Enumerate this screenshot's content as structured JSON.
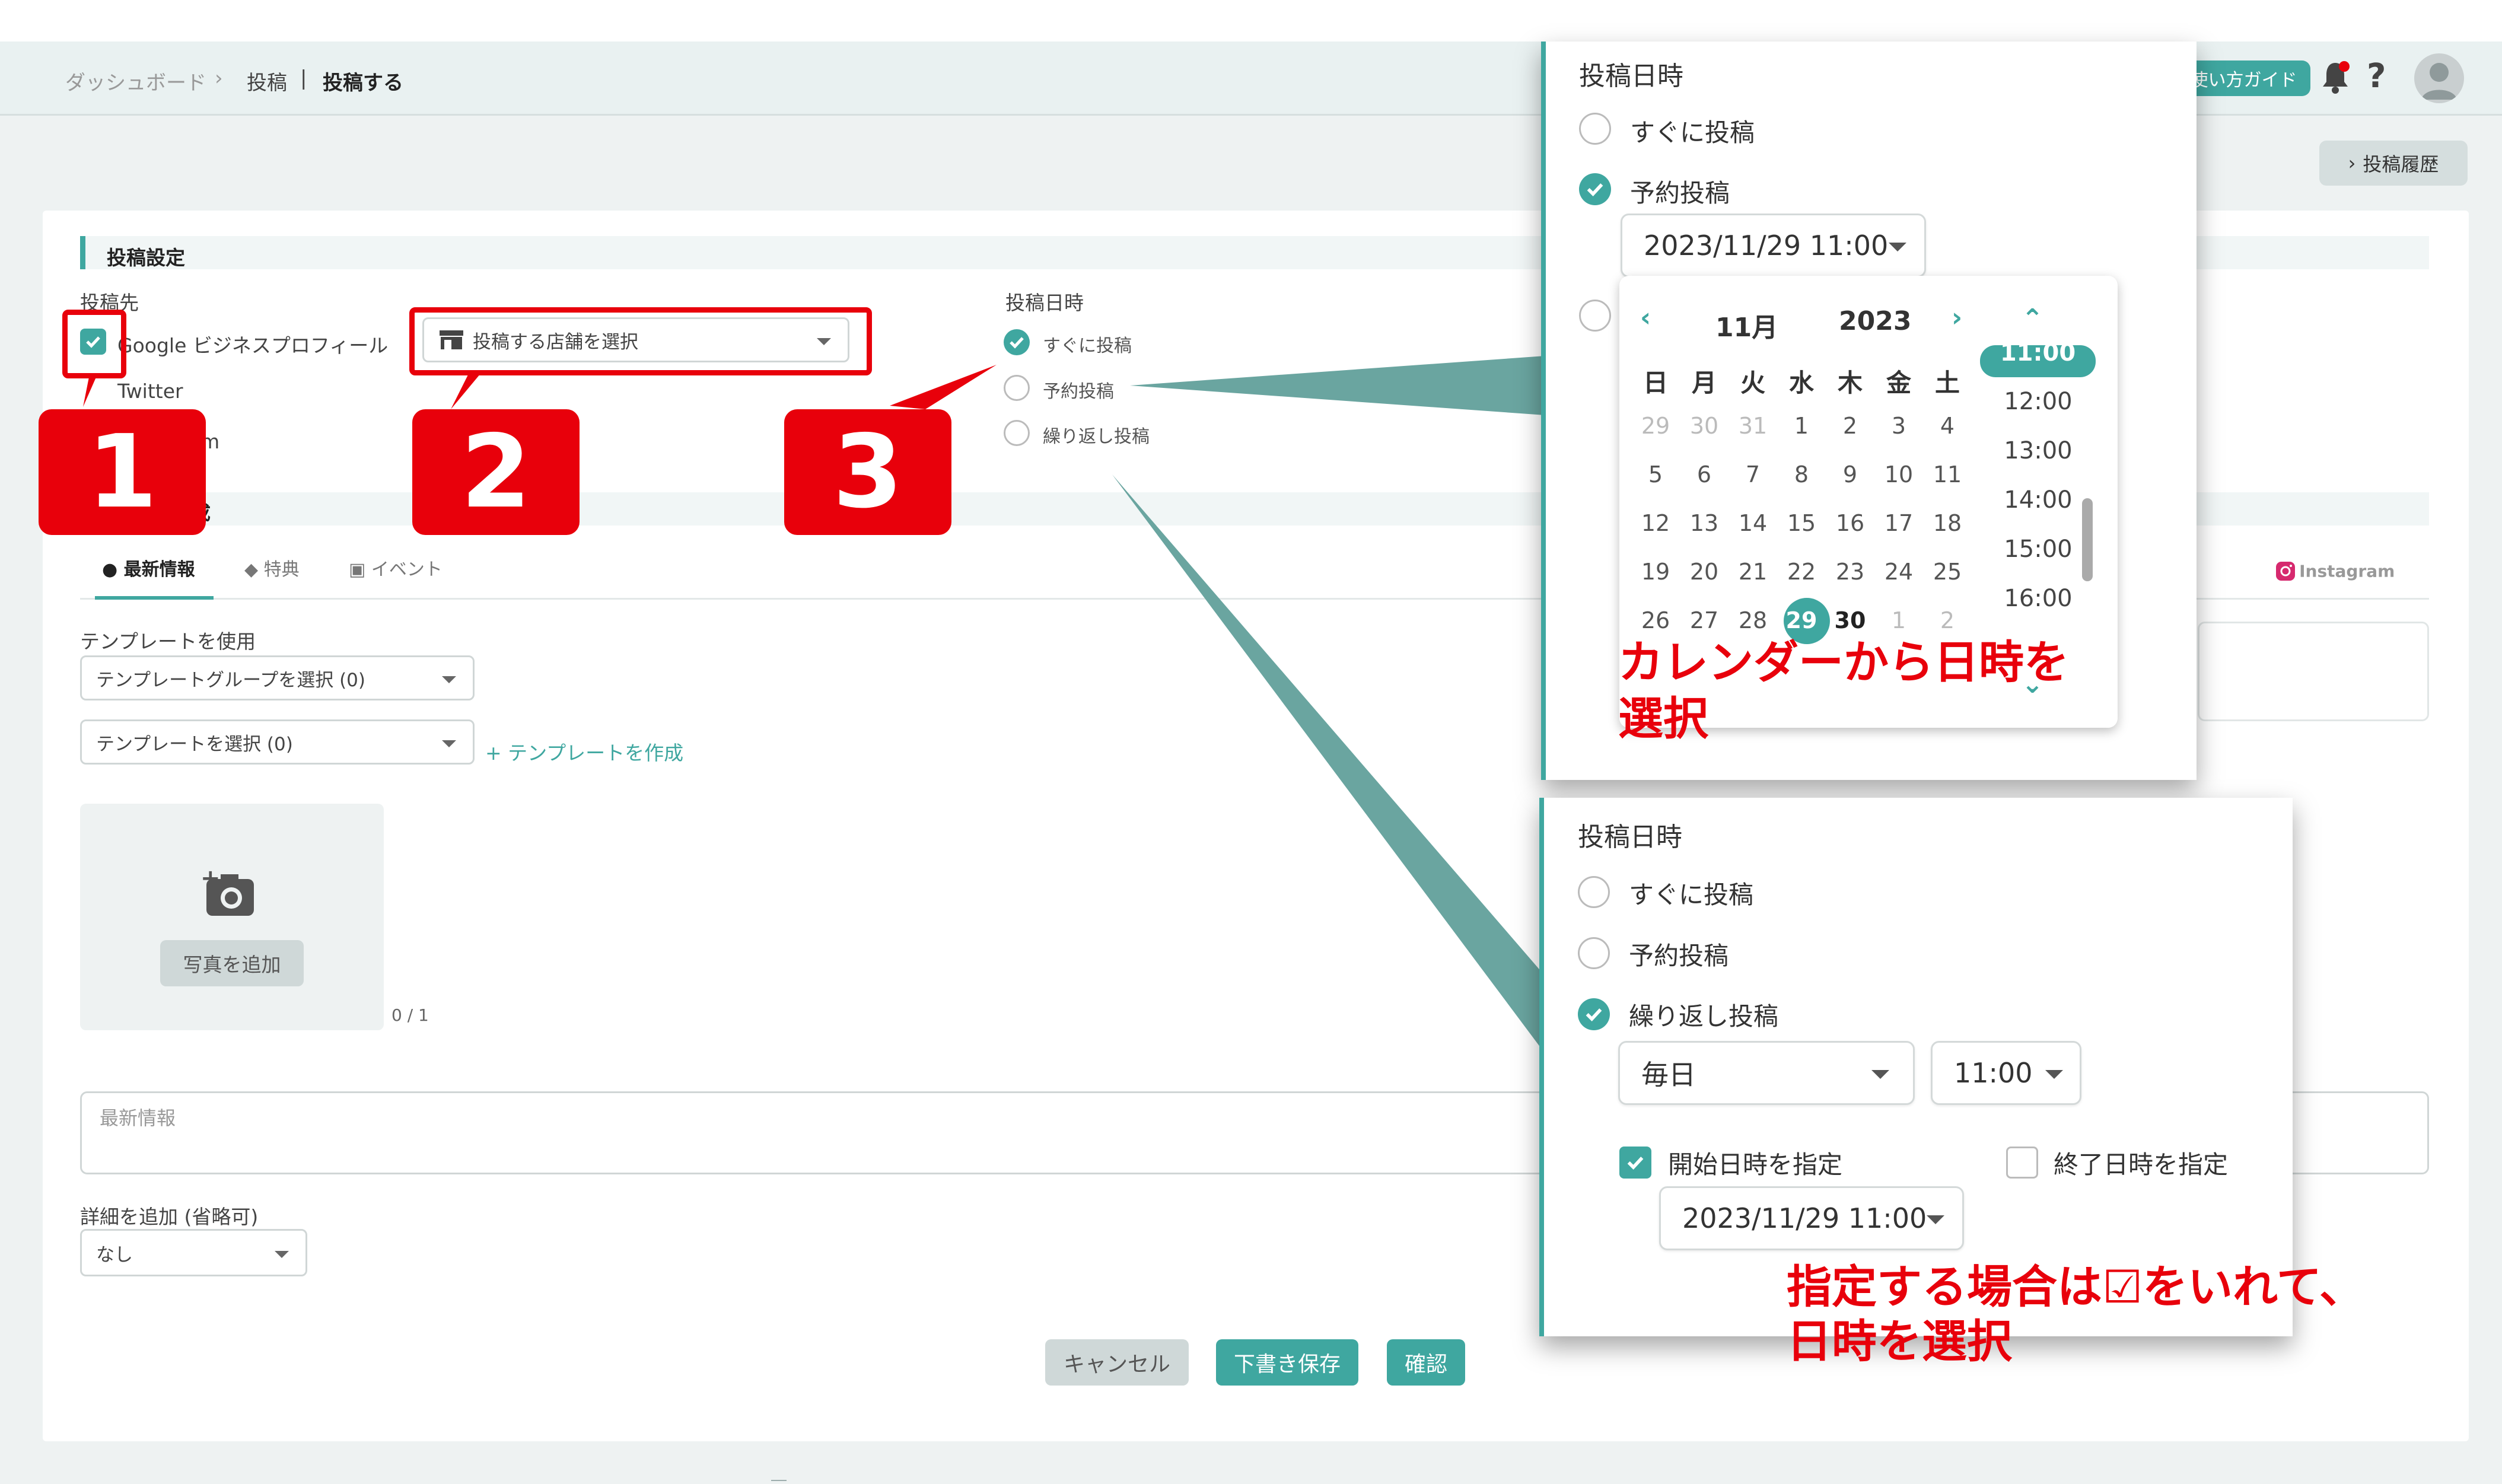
{
  "breadcrumb": {
    "home": "ダッシュボード",
    "parent": "投稿",
    "current": "投稿する"
  },
  "header": {
    "guide_label": "使い方ガイド",
    "help_label": "?",
    "history_label": "投稿履歴"
  },
  "post_settings": {
    "title": "投稿設定",
    "dest_label": "投稿先",
    "google_label": "Google ビジネスプロフィール",
    "twitter_label": "Twitter",
    "instagram_partial": "m",
    "store_select_placeholder": "投稿する店舗を選択",
    "datetime_label": "投稿日時",
    "datetime_options": [
      "すぐに投稿",
      "予約投稿",
      "繰り返し投稿"
    ]
  },
  "content": {
    "section_partial": "成",
    "tabs": [
      "最新情報",
      "特典",
      "イベント"
    ],
    "template_label": "テンプレートを使用",
    "template_group_select": "テンプレートグループを選択 (0)",
    "template_select": "テンプレートを選択 (0)",
    "create_template_link": "+ テンプレートを作成",
    "add_photo_label": "写真を追加",
    "photo_count": "0 / 1",
    "body_placeholder": "最新情報",
    "detail_label": "詳細を追加 (省略可)",
    "detail_select": "なし",
    "instagram_tab": "Instagram"
  },
  "actions": {
    "cancel": "キャンセル",
    "draft": "下書き保存",
    "confirm": "確認"
  },
  "badges": [
    "1",
    "2",
    "3"
  ],
  "popup1": {
    "title": "投稿日時",
    "options": [
      "すぐに投稿",
      "予約投稿"
    ],
    "datetime_value": "2023/11/29 11:00",
    "calendar": {
      "month": "11月",
      "year": "2023",
      "weekdays": [
        "日",
        "月",
        "火",
        "水",
        "木",
        "金",
        "土"
      ],
      "rows": [
        [
          "29",
          "30",
          "31",
          "1",
          "2",
          "3",
          "4"
        ],
        [
          "5",
          "6",
          "7",
          "8",
          "9",
          "10",
          "11"
        ],
        [
          "12",
          "13",
          "14",
          "15",
          "16",
          "17",
          "18"
        ],
        [
          "19",
          "20",
          "21",
          "22",
          "23",
          "24",
          "25"
        ],
        [
          "26",
          "27",
          "28",
          "29",
          "30",
          "1",
          "2"
        ]
      ],
      "times": [
        "11:00",
        "12:00",
        "13:00",
        "14:00",
        "15:00",
        "16:00"
      ]
    },
    "note_line1": "カレンダーから日時を",
    "note_line2": "選択"
  },
  "popup2": {
    "title": "投稿日時",
    "options": [
      "すぐに投稿",
      "予約投稿",
      "繰り返し投稿"
    ],
    "frequency_value": "毎日",
    "time_value": "11:00",
    "start_label": "開始日時を指定",
    "end_label": "終了日時を指定",
    "start_value": "2023/11/29 11:00",
    "note_line1": "指定する場合は☑をいれて、",
    "note_line2": "日時を選択"
  },
  "colors": {
    "accent": "#3fa7a0",
    "annotation_red": "#e8000b"
  }
}
